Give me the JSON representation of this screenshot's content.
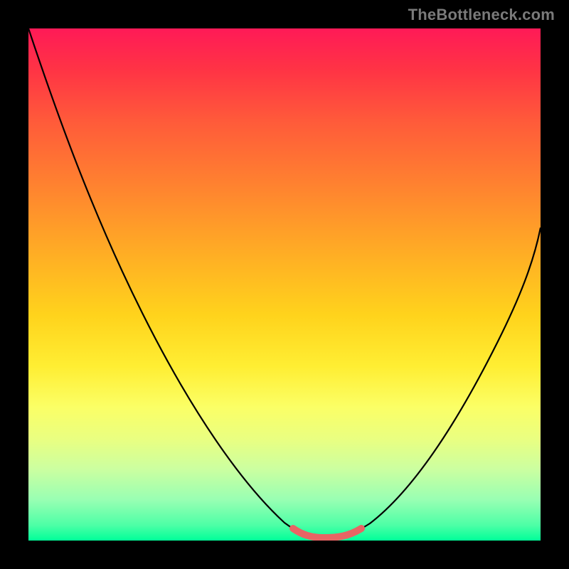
{
  "watermark": {
    "text": "TheBottleneck.com"
  },
  "colors": {
    "background": "#000000",
    "curve": "#000000",
    "highlight": "#e86464",
    "gradient_top": "#ff1a57",
    "gradient_bottom": "#00ff99"
  },
  "chart_data": {
    "type": "line",
    "title": "",
    "xlabel": "",
    "ylabel": "",
    "xlim": [
      0,
      100
    ],
    "ylim": [
      0,
      100
    ],
    "grid": false,
    "legend": false,
    "series": [
      {
        "name": "bottleneck-curve",
        "x": [
          0,
          5,
          10,
          15,
          20,
          25,
          30,
          35,
          40,
          45,
          50,
          52,
          55,
          58,
          60,
          62,
          65,
          70,
          75,
          80,
          85,
          90,
          95,
          100
        ],
        "y": [
          100,
          92,
          83,
          74,
          66,
          57,
          48,
          39,
          30,
          20,
          10,
          5,
          1.5,
          0.5,
          0.4,
          0.5,
          1.5,
          5,
          12,
          21,
          31,
          42,
          53,
          62
        ]
      }
    ],
    "highlight_region": {
      "name": "optimal-range",
      "x_start": 52,
      "x_end": 67
    },
    "background_fill": {
      "type": "vertical-gradient",
      "stops": [
        {
          "pos": 0.0,
          "color": "#ff1a57"
        },
        {
          "pos": 0.3,
          "color": "#ff8030"
        },
        {
          "pos": 0.56,
          "color": "#ffd31c"
        },
        {
          "pos": 0.8,
          "color": "#eaff80"
        },
        {
          "pos": 1.0,
          "color": "#00ff99"
        }
      ]
    }
  }
}
